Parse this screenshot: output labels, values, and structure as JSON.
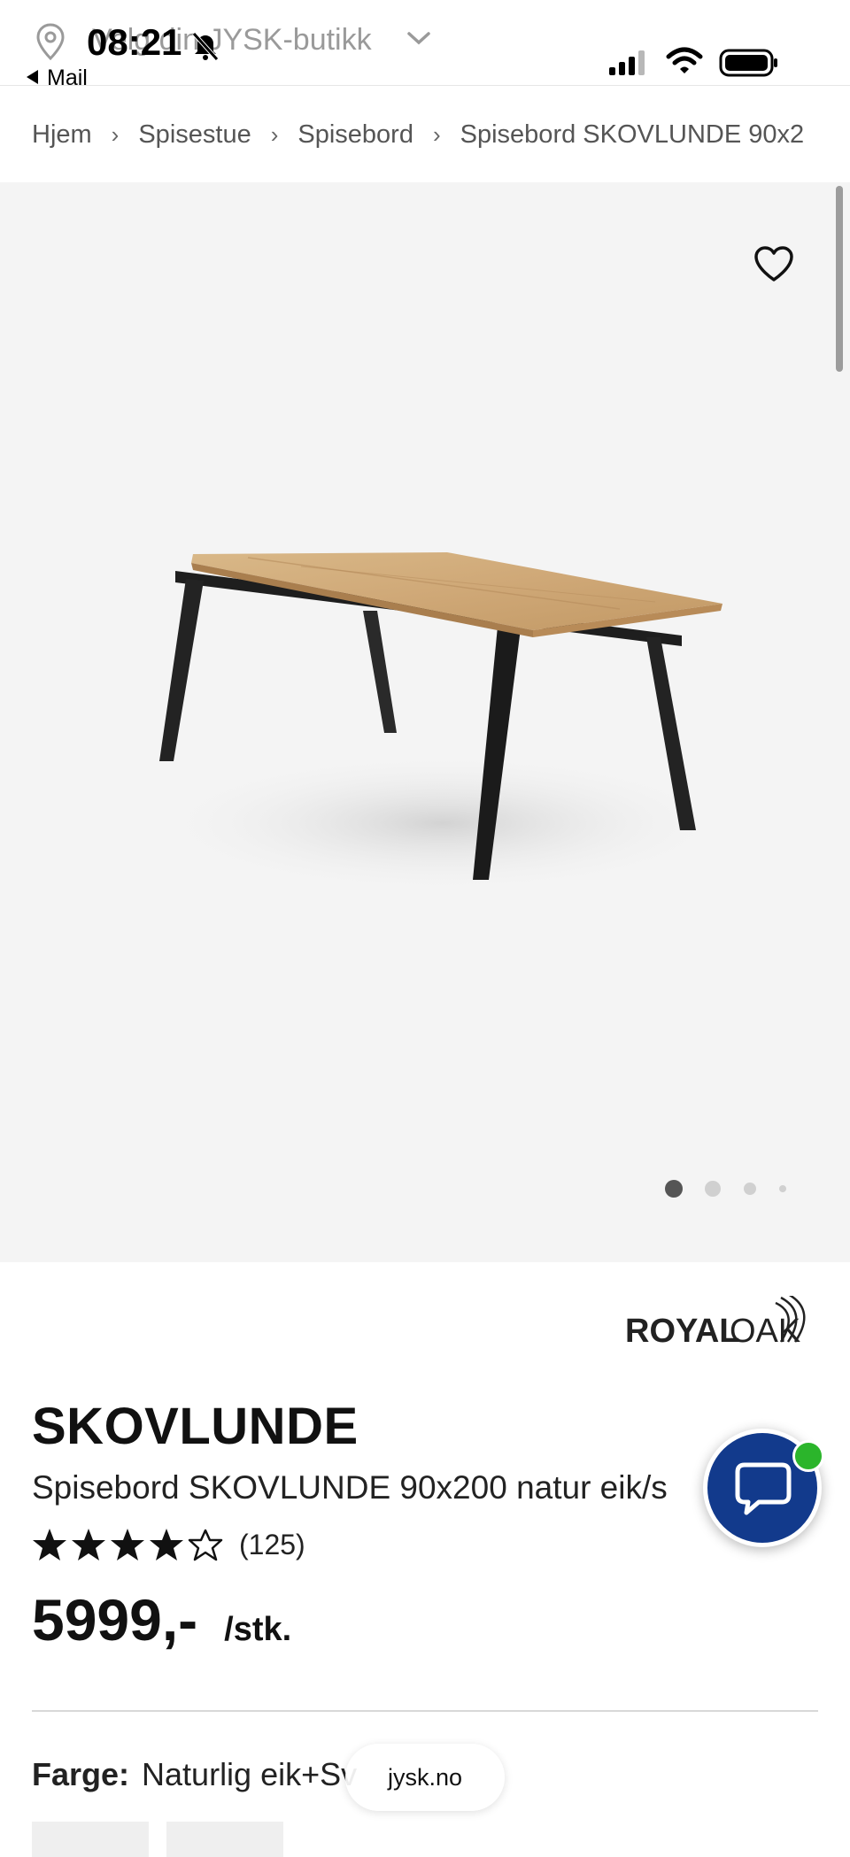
{
  "status_bar": {
    "time": "08:21",
    "back_label": "Mail",
    "store_selector_label": "Velg din JYSK-butikk",
    "icons": [
      "location-pin-icon",
      "chevron-down-icon",
      "bell-off-icon",
      "signal-icon",
      "wifi-icon",
      "battery-icon"
    ]
  },
  "breadcrumb": {
    "items": [
      "Hjem",
      "Spisestue",
      "Spisebord",
      "Spisebord SKOVLUNDE 90x2"
    ],
    "separator": "›"
  },
  "gallery": {
    "image_count": 4,
    "active_index": 0,
    "favorite_icon": "heart-outline-icon"
  },
  "product": {
    "brand": "ROYALOAK",
    "brand_part1": "ROYAL",
    "brand_part2": "OAK",
    "name": "SKOVLUNDE",
    "subtitle": "Spisebord SKOVLUNDE 90x200 natur eik/s",
    "rating_value": 4.5,
    "rating_max": 5,
    "rating_count": "(125)",
    "price": "5999,-",
    "price_unit": "/stk.",
    "color_label": "Farge:",
    "color_value": "Naturlig eik+Sv"
  },
  "browser": {
    "url": "jysk.no"
  },
  "chat": {
    "icon": "chat-bubble-icon",
    "online_color": "#2bb52b"
  },
  "colors": {
    "brand_blue": "#123a8c",
    "hero_background": "#f4f4f4",
    "online_green": "#2bb52b"
  }
}
